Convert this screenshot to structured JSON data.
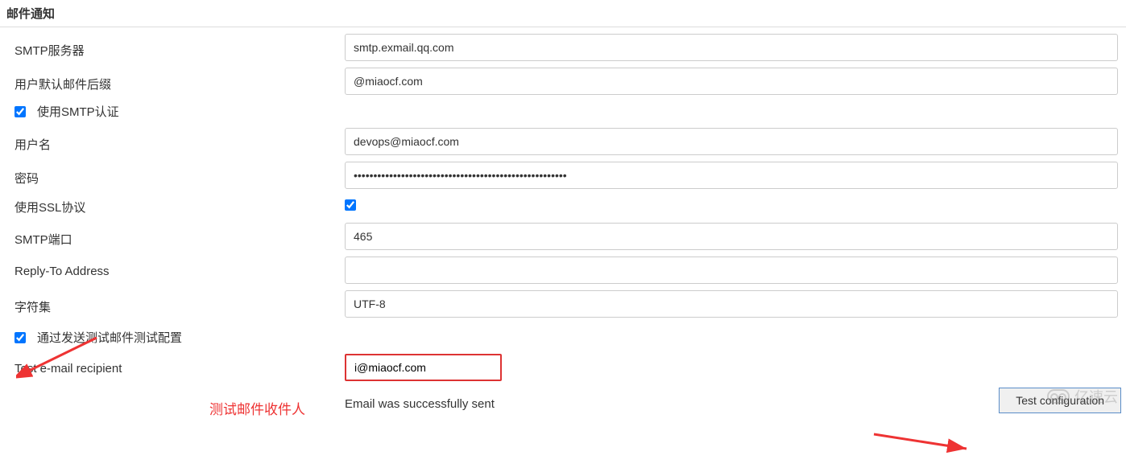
{
  "section_title": "邮件通知",
  "fields": {
    "smtp_server": {
      "label": "SMTP服务器",
      "value": "smtp.exmail.qq.com"
    },
    "default_suffix": {
      "label": "用户默认邮件后缀",
      "value": "@miaocf.com"
    },
    "use_smtp_auth": {
      "label": "使用SMTP认证",
      "checked": true
    },
    "username": {
      "label": "用户名",
      "value": "devops@miaocf.com"
    },
    "password": {
      "label": "密码",
      "value": "••••••••••••••••••••••••••••••••••••••••••••••••••••••"
    },
    "use_ssl": {
      "label": "使用SSL协议",
      "checked": true
    },
    "smtp_port": {
      "label": "SMTP端口",
      "value": "465"
    },
    "reply_to": {
      "label": "Reply-To Address",
      "value": ""
    },
    "charset": {
      "label": "字符集",
      "value": "UTF-8"
    },
    "test_by_send": {
      "label": "通过发送测试邮件测试配置",
      "checked": true
    },
    "test_recipient": {
      "label": "Test e-mail recipient",
      "value": "i@miaocf.com"
    }
  },
  "status_message": "Email was successfully sent",
  "buttons": {
    "test_config": "Test configuration"
  },
  "annotations": {
    "recipient_note": "测试邮件收件人"
  },
  "watermark": "亿速云"
}
